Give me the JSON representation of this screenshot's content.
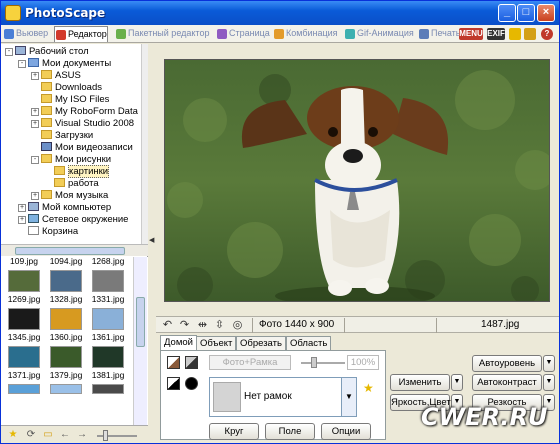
{
  "window": {
    "title": "PhotoScape"
  },
  "tabs": [
    {
      "label": "Вьювер",
      "color": "#4a7fd6"
    },
    {
      "label": "Редактор",
      "color": "#d23a2c"
    },
    {
      "label": "Пакетный редактор",
      "color": "#6ab04c"
    },
    {
      "label": "Страница",
      "color": "#8f5bc2"
    },
    {
      "label": "Комбинация",
      "color": "#e39b2a"
    },
    {
      "label": "Gif-Анимация",
      "color": "#3cb0b0"
    },
    {
      "label": "Печать",
      "color": "#5c7db8"
    }
  ],
  "toolbar_icons": {
    "menu": "MENU",
    "exif": "EXIF"
  },
  "tree": [
    {
      "label": "Рабочий стол",
      "icon": "desktop-icon",
      "exp": "-"
    },
    {
      "label": "Мои документы",
      "icon": "documents-icon",
      "exp": "-"
    },
    {
      "label": "ASUS",
      "icon": "folder-icon",
      "exp": "+"
    },
    {
      "label": "Downloads",
      "icon": "folder-icon",
      "exp": ""
    },
    {
      "label": "My ISO Files",
      "icon": "folder-icon",
      "exp": ""
    },
    {
      "label": "My RoboForm Data",
      "icon": "folder-icon",
      "exp": "+"
    },
    {
      "label": "Visual Studio 2008",
      "icon": "folder-icon",
      "exp": "+"
    },
    {
      "label": "Загрузки",
      "icon": "folder-icon",
      "exp": ""
    },
    {
      "label": "Мои видеозаписи",
      "icon": "video-folder-icon",
      "exp": ""
    },
    {
      "label": "Мои рисунки",
      "icon": "pictures-folder-icon",
      "exp": "-"
    },
    {
      "label": "картинки",
      "icon": "folder-icon",
      "exp": ""
    },
    {
      "label": "работа",
      "icon": "folder-icon",
      "exp": ""
    },
    {
      "label": "Моя музыка",
      "icon": "music-folder-icon",
      "exp": "+"
    },
    {
      "label": "Мой компьютер",
      "icon": "computer-icon",
      "exp": "+"
    },
    {
      "label": "Сетевое окружение",
      "icon": "network-icon",
      "exp": "+"
    },
    {
      "label": "Корзина",
      "icon": "recycle-bin-icon",
      "exp": ""
    }
  ],
  "thumbnails": [
    {
      "name": "109.jpg",
      "color": "#556b3a"
    },
    {
      "name": "1094.jpg",
      "color": "#4a6a8a"
    },
    {
      "name": "1268.jpg",
      "color": "#7a7a7a"
    },
    {
      "name": "1269.jpg",
      "color": "#1a1a1a"
    },
    {
      "name": "1328.jpg",
      "color": "#d79a20"
    },
    {
      "name": "1331.jpg",
      "color": "#8ab0d8"
    },
    {
      "name": "1345.jpg",
      "color": "#2a6e8e"
    },
    {
      "name": "1360.jpg",
      "color": "#3a5a2a"
    },
    {
      "name": "1361.jpg",
      "color": "#203828"
    },
    {
      "name": "1371.jpg",
      "color": "#5aa0d8"
    },
    {
      "name": "1379.jpg",
      "color": "#9ac0e8"
    },
    {
      "name": "1381.jpg",
      "color": "#4a4a4a"
    }
  ],
  "status": {
    "photo_info": "Фото 1440 x 900",
    "file_name": "1487.jpg"
  },
  "edit_tabs": [
    "Домой",
    "Объект",
    "Обрезать",
    "Область"
  ],
  "home": {
    "frame_button": "Фото+Рамка",
    "percent": "100%",
    "frame_select": "Нет рамок",
    "bottom_buttons": [
      "Круг",
      "Поле",
      "Опции"
    ]
  },
  "right_buttons": {
    "auto_level": "Автоуровень",
    "resize": "Изменить",
    "auto_contrast": "Автоконтраст",
    "bright_color": "Яркость,Цвет",
    "sharpen": "Резкость"
  },
  "watermark": "CWER.RU"
}
